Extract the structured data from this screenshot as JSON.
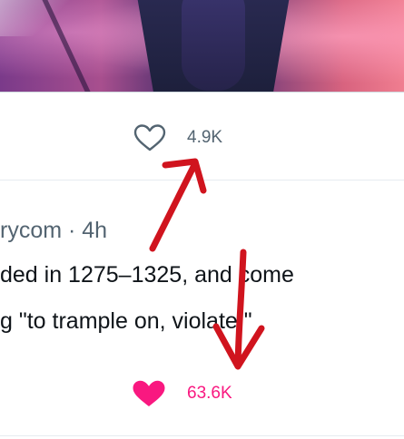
{
  "post_top": {
    "like_icon": "heart-outline-icon",
    "like_count": "4.9K",
    "like_color": "#536471"
  },
  "post_bottom": {
    "header": "rycom · 4h",
    "text_lines": [
      "ded in 1275–1325, and come",
      "g \"to trample on, violate.\""
    ],
    "like_icon": "heart-filled-icon",
    "like_count": "63.6K",
    "like_color": "#f91880"
  },
  "annotation": {
    "arrow_color": "#d0141e",
    "arrows": [
      "arrow-up-icon",
      "arrow-down-icon"
    ]
  }
}
